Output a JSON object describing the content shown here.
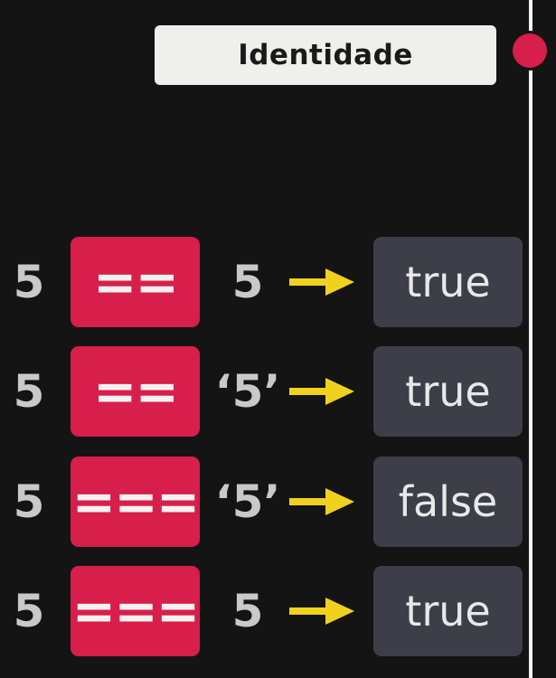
{
  "title": "Identidade",
  "colors": {
    "background": "#141414",
    "operator_box": "#d81e4a",
    "result_box": "#3d3e48",
    "arrow": "#f0d21e",
    "timeline_dot": "#d81e4a",
    "title_box": "#efefeb"
  },
  "rows": [
    {
      "left": "5",
      "operator": "==",
      "right": "5",
      "result": "true"
    },
    {
      "left": "5",
      "operator": "==",
      "right": "‘5’",
      "result": "true"
    },
    {
      "left": "5",
      "operator": "===",
      "right": "‘5’",
      "result": "false"
    },
    {
      "left": "5",
      "operator": "===",
      "right": "5",
      "result": "true"
    }
  ]
}
